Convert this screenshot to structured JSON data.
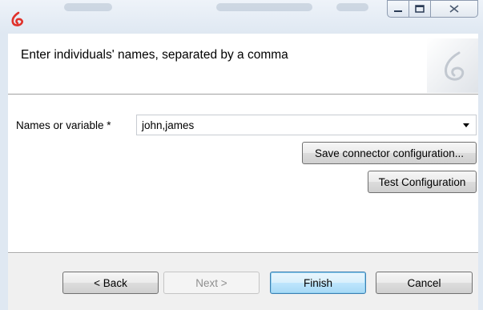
{
  "wizard": {
    "instruction": "Enter individuals' names, separated by a comma"
  },
  "form": {
    "names_label": "Names or variable *",
    "names_value": "john,james"
  },
  "actions": {
    "save_config_label": "Save connector configuration...",
    "test_config_label": "Test Configuration"
  },
  "footer": {
    "back_label": "< Back",
    "next_label": "Next >",
    "finish_label": "Finish",
    "cancel_label": "Cancel"
  },
  "icons": {
    "app": "bonita-app-icon",
    "logo": "bonita-logo-watermark",
    "minimize": "minimize-icon",
    "maximize": "maximize-icon",
    "close": "close-icon",
    "dropdown": "chevron-down-icon"
  },
  "colors": {
    "app_icon": "#e0312a",
    "finish_border": "#3c7fb1"
  }
}
